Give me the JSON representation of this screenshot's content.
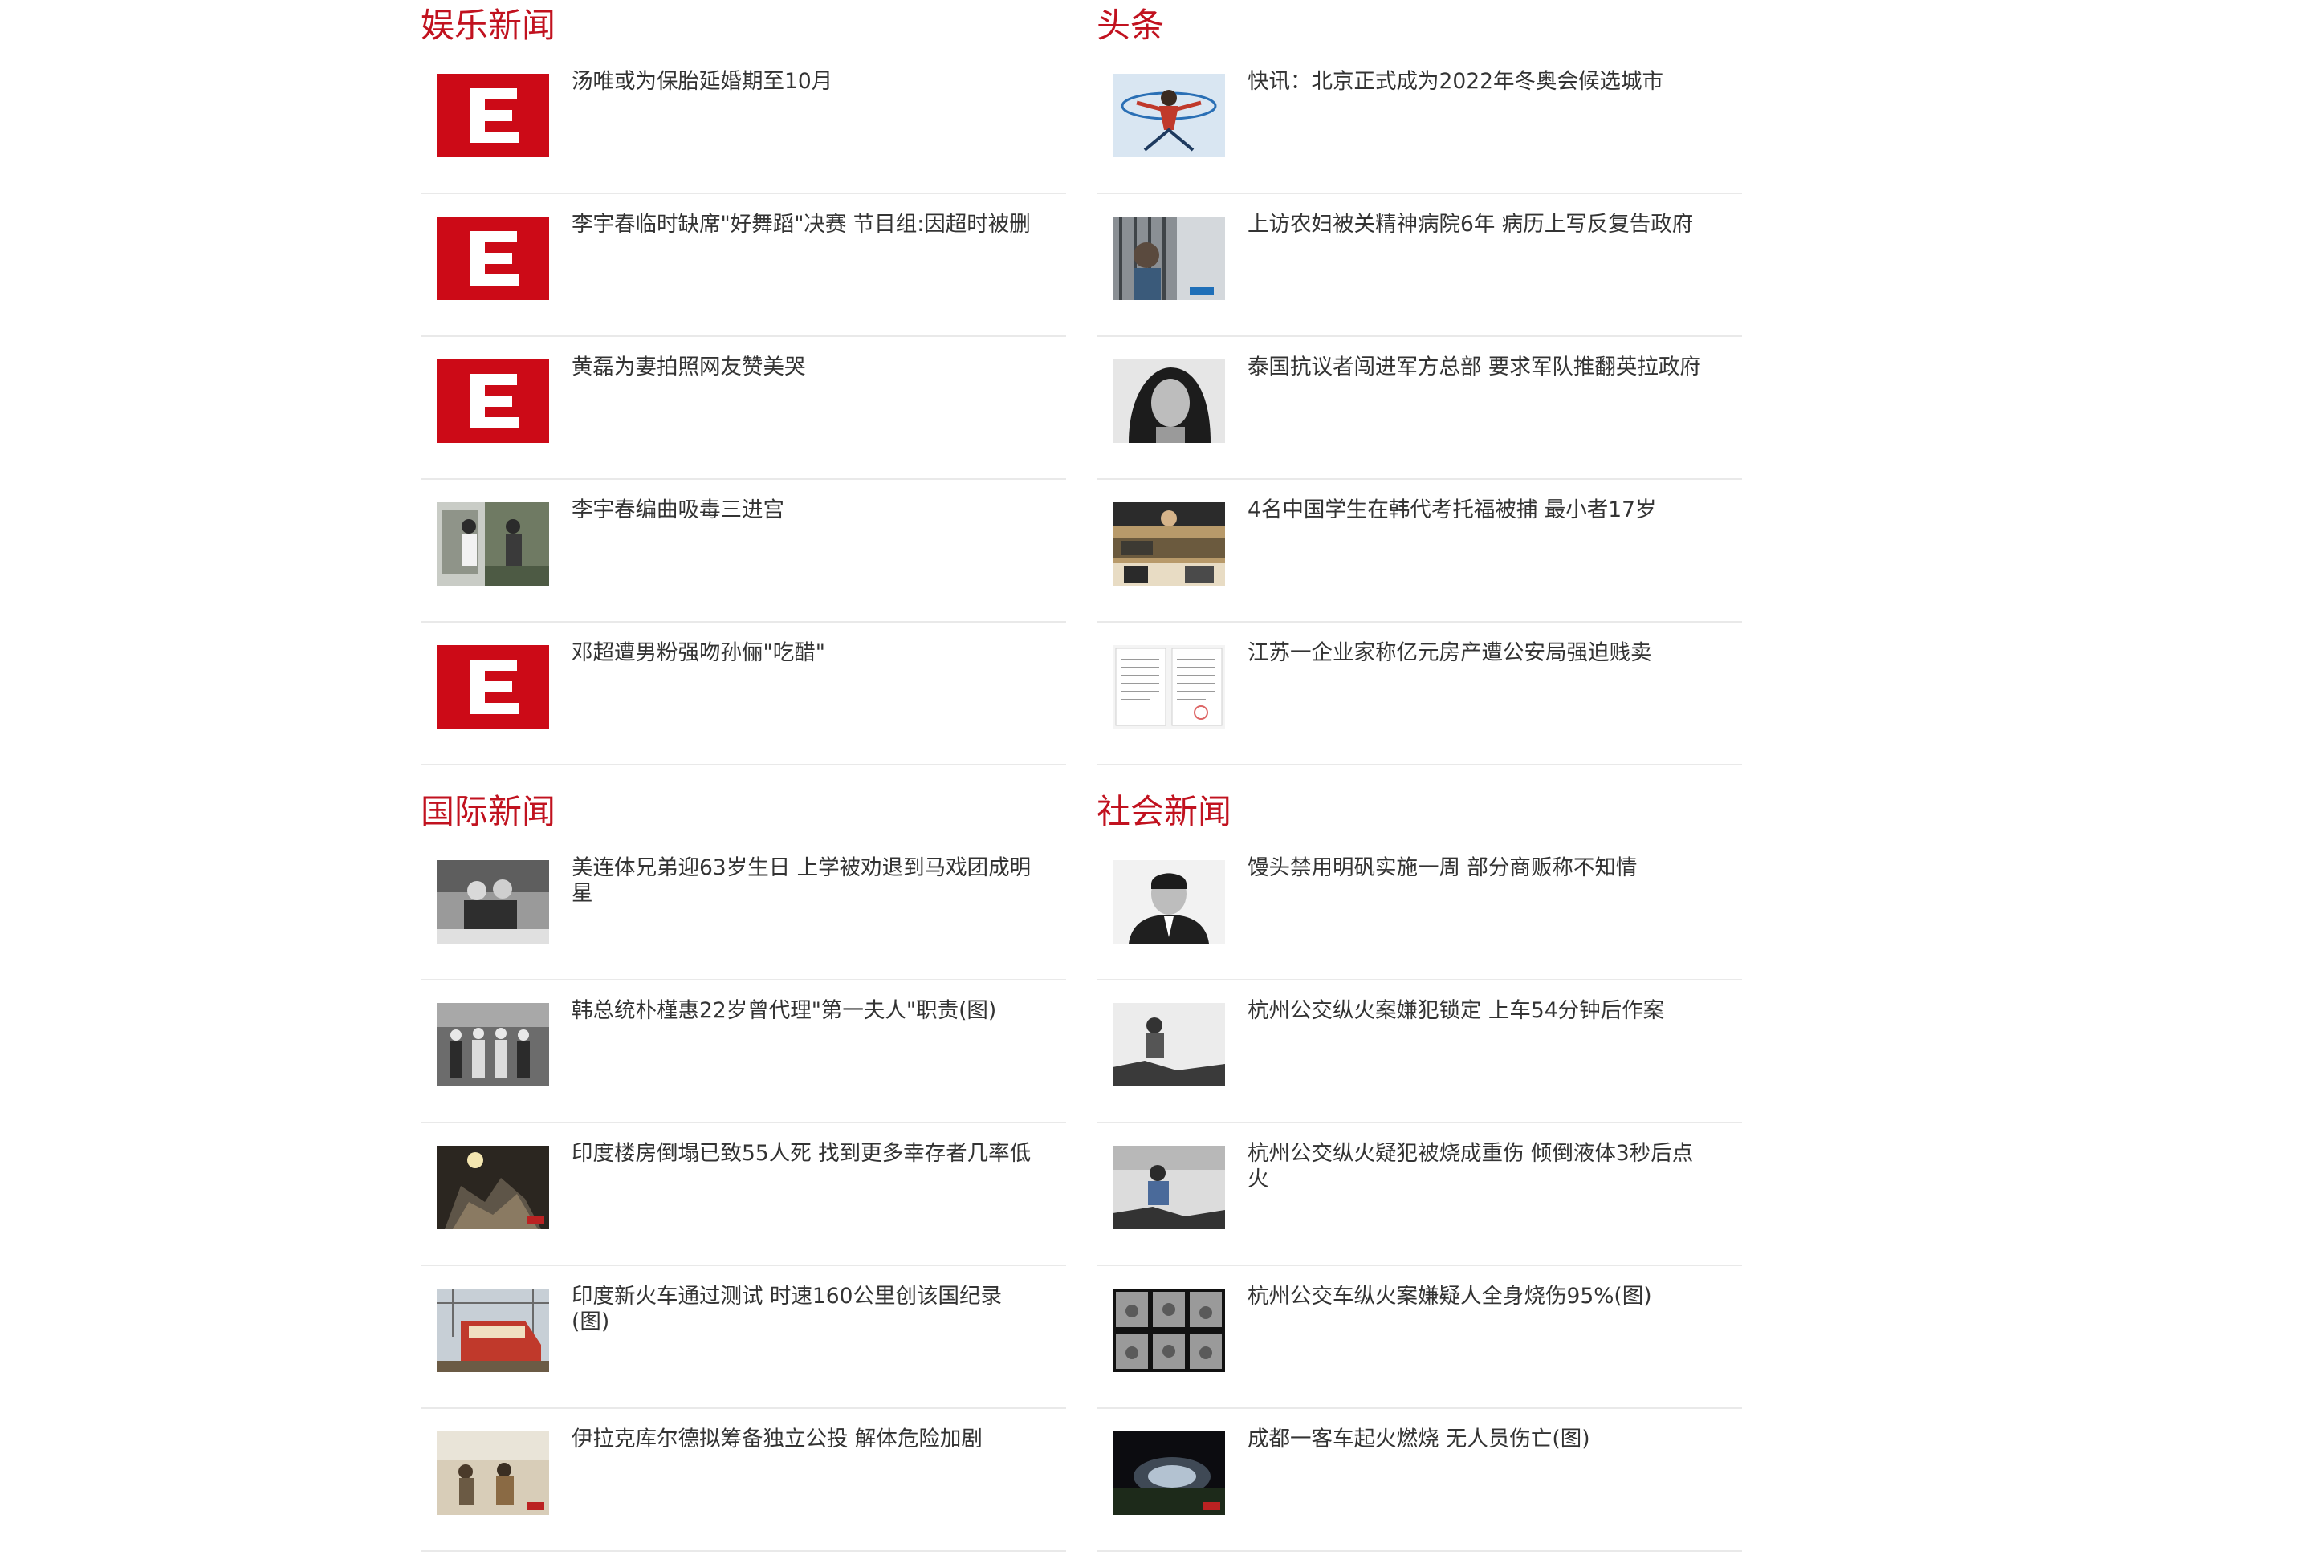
{
  "colors": {
    "section_title": "#c1121f",
    "headline_text": "#333333",
    "divider": "#e9e9e9"
  },
  "sections": [
    {
      "title": "娱乐新闻",
      "items": [
        {
          "headline": "汤唯或为保胎延婚期至10月",
          "thumb": "e-logo"
        },
        {
          "headline": "李宇春临时缺席\"好舞蹈\"决赛 节目组:因超时被删",
          "thumb": "e-logo"
        },
        {
          "headline": "黄磊为妻拍照网友赞美哭",
          "thumb": "e-logo"
        },
        {
          "headline": "李宇春编曲吸毒三进宫",
          "thumb": "photo"
        },
        {
          "headline": "邓超遭男粉强吻孙俪\"吃醋\"",
          "thumb": "e-logo"
        }
      ]
    },
    {
      "title": "头条",
      "items": [
        {
          "headline": "快讯：北京正式成为2022年冬奥会候选城市",
          "thumb": "photo"
        },
        {
          "headline": "上访农妇被关精神病院6年 病历上写反复告政府",
          "thumb": "photo"
        },
        {
          "headline": "泰国抗议者闯进军方总部 要求军队推翻英拉政府",
          "thumb": "photo"
        },
        {
          "headline": "4名中国学生在韩代考托福被捕 最小者17岁",
          "thumb": "photo"
        },
        {
          "headline": "江苏一企业家称亿元房产遭公安局强迫贱卖",
          "thumb": "document"
        }
      ]
    },
    {
      "title": "国际新闻",
      "items": [
        {
          "headline": "美连体兄弟迎63岁生日 上学被劝退到马戏团成明星",
          "thumb": "photo"
        },
        {
          "headline": "韩总统朴槿惠22岁曾代理\"第一夫人\"职责(图)",
          "thumb": "photo"
        },
        {
          "headline": "印度楼房倒塌已致55人死 找到更多幸存者几率低",
          "thumb": "photo"
        },
        {
          "headline": "印度新火车通过测试 时速160公里创该国纪录(图)",
          "thumb": "photo"
        },
        {
          "headline": "伊拉克库尔德拟筹备独立公投 解体危险加剧",
          "thumb": "photo"
        }
      ]
    },
    {
      "title": "社会新闻",
      "items": [
        {
          "headline": "馒头禁用明矾实施一周 部分商贩称不知情",
          "thumb": "photo"
        },
        {
          "headline": "杭州公交纵火案嫌犯锁定 上车54分钟后作案",
          "thumb": "photo"
        },
        {
          "headline": "杭州公交纵火疑犯被烧成重伤 倾倒液体3秒后点火",
          "thumb": "photo"
        },
        {
          "headline": "杭州公交车纵火案嫌疑人全身烧伤95%(图)",
          "thumb": "photo-grid"
        },
        {
          "headline": "成都一客车起火燃烧 无人员伤亡(图)",
          "thumb": "photo"
        }
      ]
    }
  ]
}
